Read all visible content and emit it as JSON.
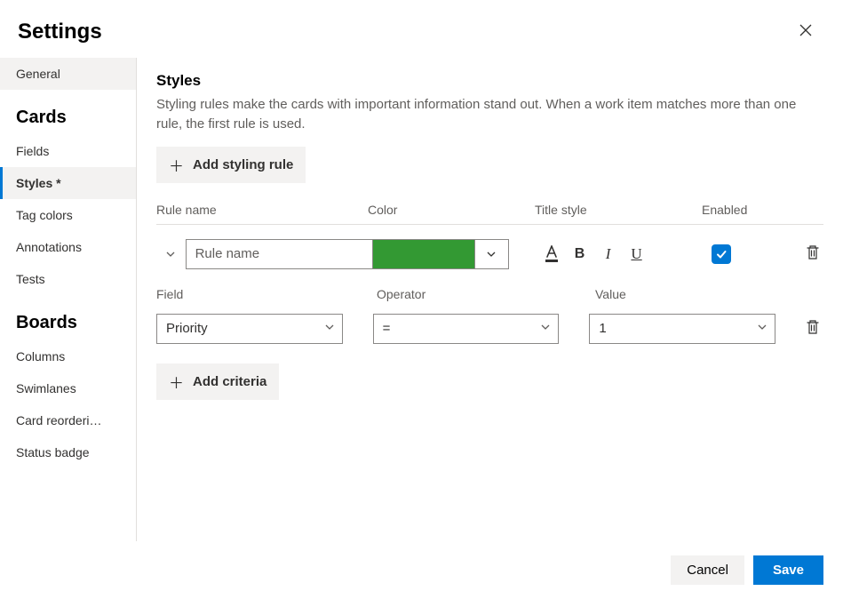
{
  "header": {
    "title": "Settings"
  },
  "sidebar": {
    "general": "General",
    "sections": [
      {
        "title": "Cards",
        "items": [
          "Fields",
          "Styles *",
          "Tag colors",
          "Annotations",
          "Tests"
        ]
      },
      {
        "title": "Boards",
        "items": [
          "Columns",
          "Swimlanes",
          "Card reorderi…",
          "Status badge"
        ]
      }
    ],
    "active": "Styles *"
  },
  "main": {
    "title": "Styles",
    "description": "Styling rules make the cards with important information stand out. When a work item matches more than one rule, the first rule is used.",
    "add_rule_label": "Add styling rule",
    "columns": {
      "name": "Rule name",
      "color": "Color",
      "title_style": "Title style",
      "enabled": "Enabled"
    },
    "rule": {
      "name_placeholder": "Rule name",
      "name_value": "",
      "color": "#339933",
      "bold": false,
      "italic": false,
      "underline": false,
      "enabled": true
    },
    "criteria_headers": {
      "field": "Field",
      "operator": "Operator",
      "value": "Value"
    },
    "criteria": [
      {
        "field": "Priority",
        "operator": "=",
        "value": "1"
      }
    ],
    "add_criteria_label": "Add criteria"
  },
  "footer": {
    "cancel": "Cancel",
    "save": "Save"
  }
}
